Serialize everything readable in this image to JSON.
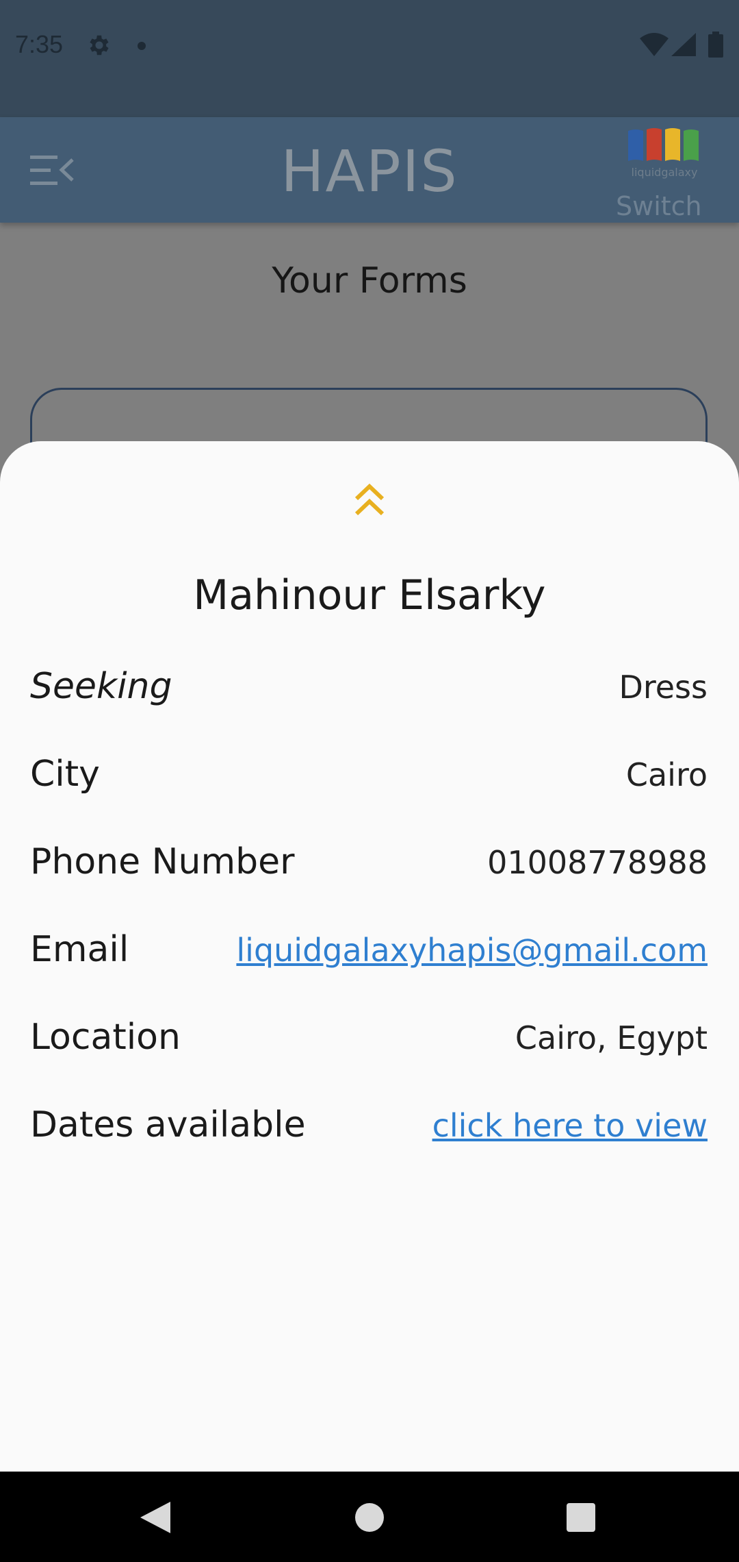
{
  "status_bar": {
    "time": "7:35"
  },
  "app_bar": {
    "title": "HAPIS",
    "logo_caption": "liquidgalaxy",
    "switch_label": "Switch",
    "logo_colors": [
      "#2f5fa8",
      "#c8402e",
      "#e8b62a",
      "#4aa04a"
    ]
  },
  "page": {
    "heading": "Your Forms"
  },
  "sheet": {
    "name": "Mahinour Elsarky",
    "accent_color": "#e8b020",
    "link_color": "#2f7fd0",
    "rows": [
      {
        "label": "Seeking",
        "value": "Dress"
      },
      {
        "label": "City",
        "value": "Cairo"
      },
      {
        "label": "Phone Number",
        "value": "01008778988"
      },
      {
        "label": "Email",
        "value": "liquidgalaxyhapis@gmail.com"
      },
      {
        "label": "Location",
        "value": "Cairo, Egypt"
      },
      {
        "label": "Dates available",
        "value": "click here to view"
      }
    ]
  },
  "icons": {
    "status": [
      "gear-icon",
      "notification-dot-icon",
      "wifi-icon",
      "signal-icon",
      "battery-icon"
    ],
    "app_bar": [
      "menu-icon",
      "liquid-galaxy-logo"
    ],
    "sheet": [
      "chevron-up-icon"
    ],
    "nav": [
      "back-icon",
      "home-icon",
      "recents-icon"
    ]
  }
}
